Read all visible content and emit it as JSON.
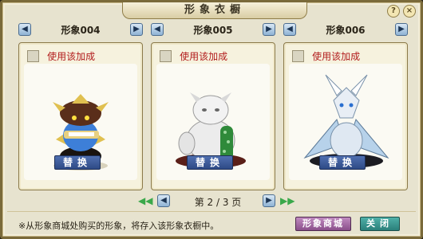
{
  "window": {
    "title": "形象衣橱",
    "help_glyph": "?",
    "close_glyph": "×"
  },
  "panels": [
    {
      "title": "形象004",
      "checkbox_label": "使用该加成",
      "replace_label": "替换",
      "prev_glyph": "◀",
      "next_glyph": "▶"
    },
    {
      "title": "形象005",
      "checkbox_label": "使用该加成",
      "replace_label": "替换",
      "prev_glyph": "◀",
      "next_glyph": "▶"
    },
    {
      "title": "形象006",
      "checkbox_label": "使用该加成",
      "replace_label": "替换",
      "prev_glyph": "◀",
      "next_glyph": "▶"
    }
  ],
  "pager": {
    "first_glyph": "◀◀",
    "prev_glyph": "◀",
    "page_text": "第 2 / 3 页",
    "next_glyph": "▶",
    "last_glyph": "▶▶"
  },
  "footer": {
    "note": "※从形象商城处购买的形象，将存入该形象衣橱中。",
    "shop_label": "形象商城",
    "close_label": "关闭"
  },
  "colors": {
    "frame": "#7a6a3a",
    "background": "#e7e3cf",
    "label_red": "#b21c1c",
    "button_blue": "#2e4a86"
  }
}
